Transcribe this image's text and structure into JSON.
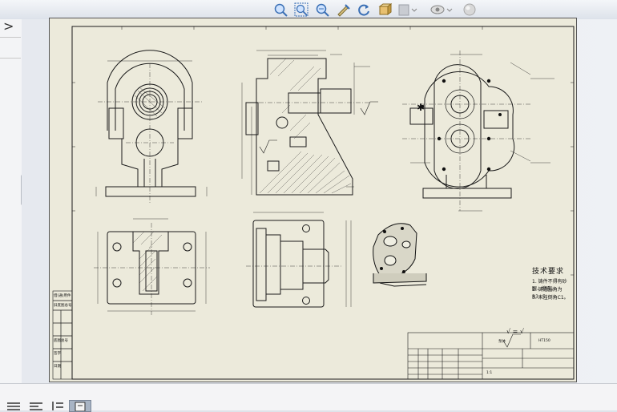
{
  "toolbar": {
    "icons": [
      "zoom-to-fit-icon",
      "zoom-to-area-icon",
      "zoom-in-out-icon",
      "select-icon",
      "rotate-icon",
      "view-orientation-icon",
      "display-style-icon",
      "hide-show-icon",
      "appearance-icon"
    ]
  },
  "left_panel": {
    "expand_chevron": ">"
  },
  "drawing": {
    "tech_req_title": "技术要求",
    "tech_req_lines": [
      "1. 铸件不得有砂眼、缩孔。",
      "2. 铸造圆角为R3~5。",
      "3. 未注倒角C1。"
    ],
    "roughness_note": "√ = √",
    "asterisk_mark": "✱",
    "title_block": {
      "material": "HT150",
      "scale": "1:1",
      "drawing_label": "泵体"
    },
    "left_side_labels": [
      "借(通)用件",
      "旧底图总号",
      "底图总号",
      "签字",
      "日期"
    ]
  },
  "bottom_bar": {
    "icons": [
      "list-view-icon",
      "detail-view-icon",
      "sort-icon",
      "sheet-tab-icon"
    ]
  }
}
